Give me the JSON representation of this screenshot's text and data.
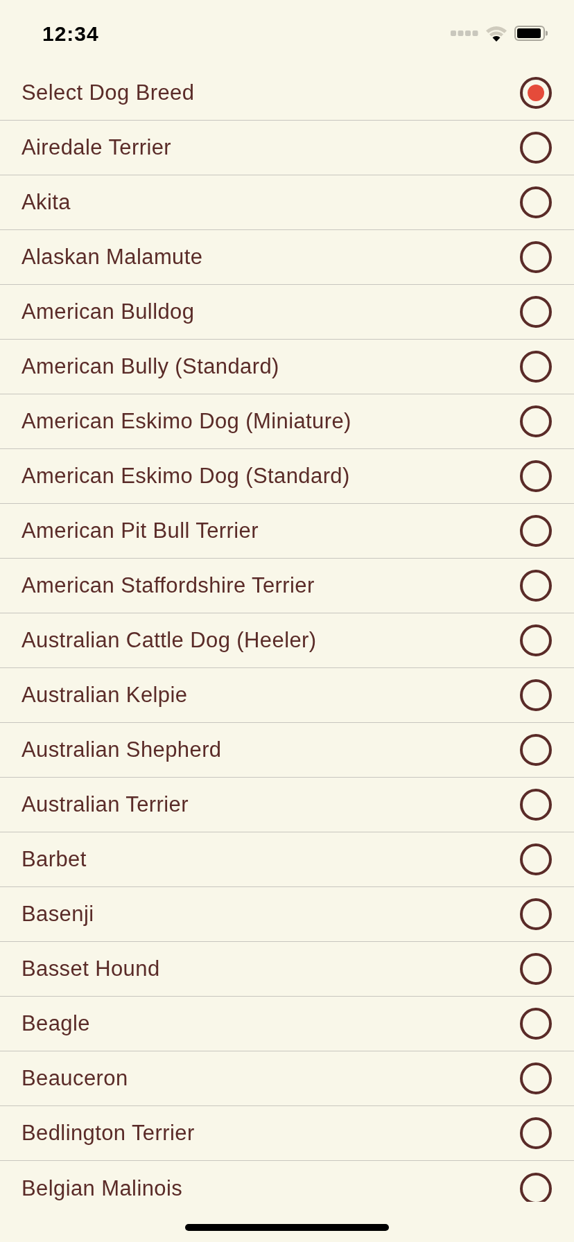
{
  "status_bar": {
    "time": "12:34"
  },
  "options": [
    {
      "label": "Select Dog Breed",
      "selected": true
    },
    {
      "label": "Airedale Terrier",
      "selected": false
    },
    {
      "label": "Akita",
      "selected": false
    },
    {
      "label": "Alaskan Malamute",
      "selected": false
    },
    {
      "label": "American Bulldog",
      "selected": false
    },
    {
      "label": "American Bully (Standard)",
      "selected": false
    },
    {
      "label": "American Eskimo Dog (Miniature)",
      "selected": false
    },
    {
      "label": "American Eskimo Dog (Standard)",
      "selected": false
    },
    {
      "label": "American Pit Bull Terrier",
      "selected": false
    },
    {
      "label": "American Staffordshire Terrier",
      "selected": false
    },
    {
      "label": "Australian Cattle Dog (Heeler)",
      "selected": false
    },
    {
      "label": "Australian Kelpie",
      "selected": false
    },
    {
      "label": "Australian Shepherd",
      "selected": false
    },
    {
      "label": "Australian Terrier",
      "selected": false
    },
    {
      "label": "Barbet",
      "selected": false
    },
    {
      "label": "Basenji",
      "selected": false
    },
    {
      "label": "Basset Hound",
      "selected": false
    },
    {
      "label": "Beagle",
      "selected": false
    },
    {
      "label": "Beauceron",
      "selected": false
    },
    {
      "label": "Bedlington Terrier",
      "selected": false
    },
    {
      "label": "Belgian Malinois",
      "selected": false
    }
  ]
}
